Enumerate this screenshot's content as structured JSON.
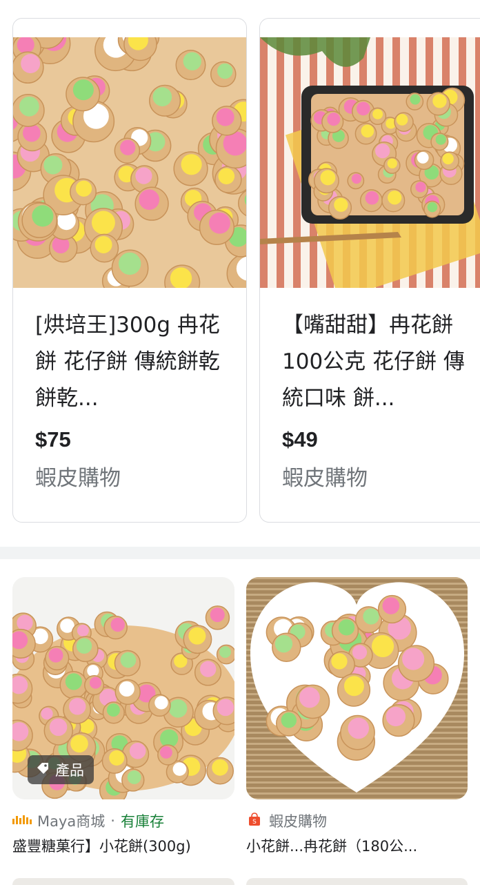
{
  "cards": [
    {
      "title": "[烘培王]300g 冉花餅 花仔餅 傳統餅乾 餅乾...",
      "price": "$75",
      "store": "蝦皮購物"
    },
    {
      "title": "【嘴甜甜】冉花餅 100公克 花仔餅 傳統口味 餅...",
      "price": "$49",
      "store": "蝦皮購物"
    }
  ],
  "products": [
    {
      "badge": "產品",
      "store": "Maya商城",
      "separator": "·",
      "stock": "有庫存",
      "title": "盛豐糖菓行】小花餅(300g)"
    },
    {
      "store": "蝦皮購物",
      "title": "小花餅...冉花餅（180公..."
    }
  ],
  "colors": {
    "in_stock": "#188038",
    "secondary_text": "#70757a",
    "shopee": "#ee4d2d",
    "maya": "#f29900"
  },
  "icons": [
    "tag-icon",
    "maya-logo-icon",
    "shopee-bag-icon"
  ]
}
